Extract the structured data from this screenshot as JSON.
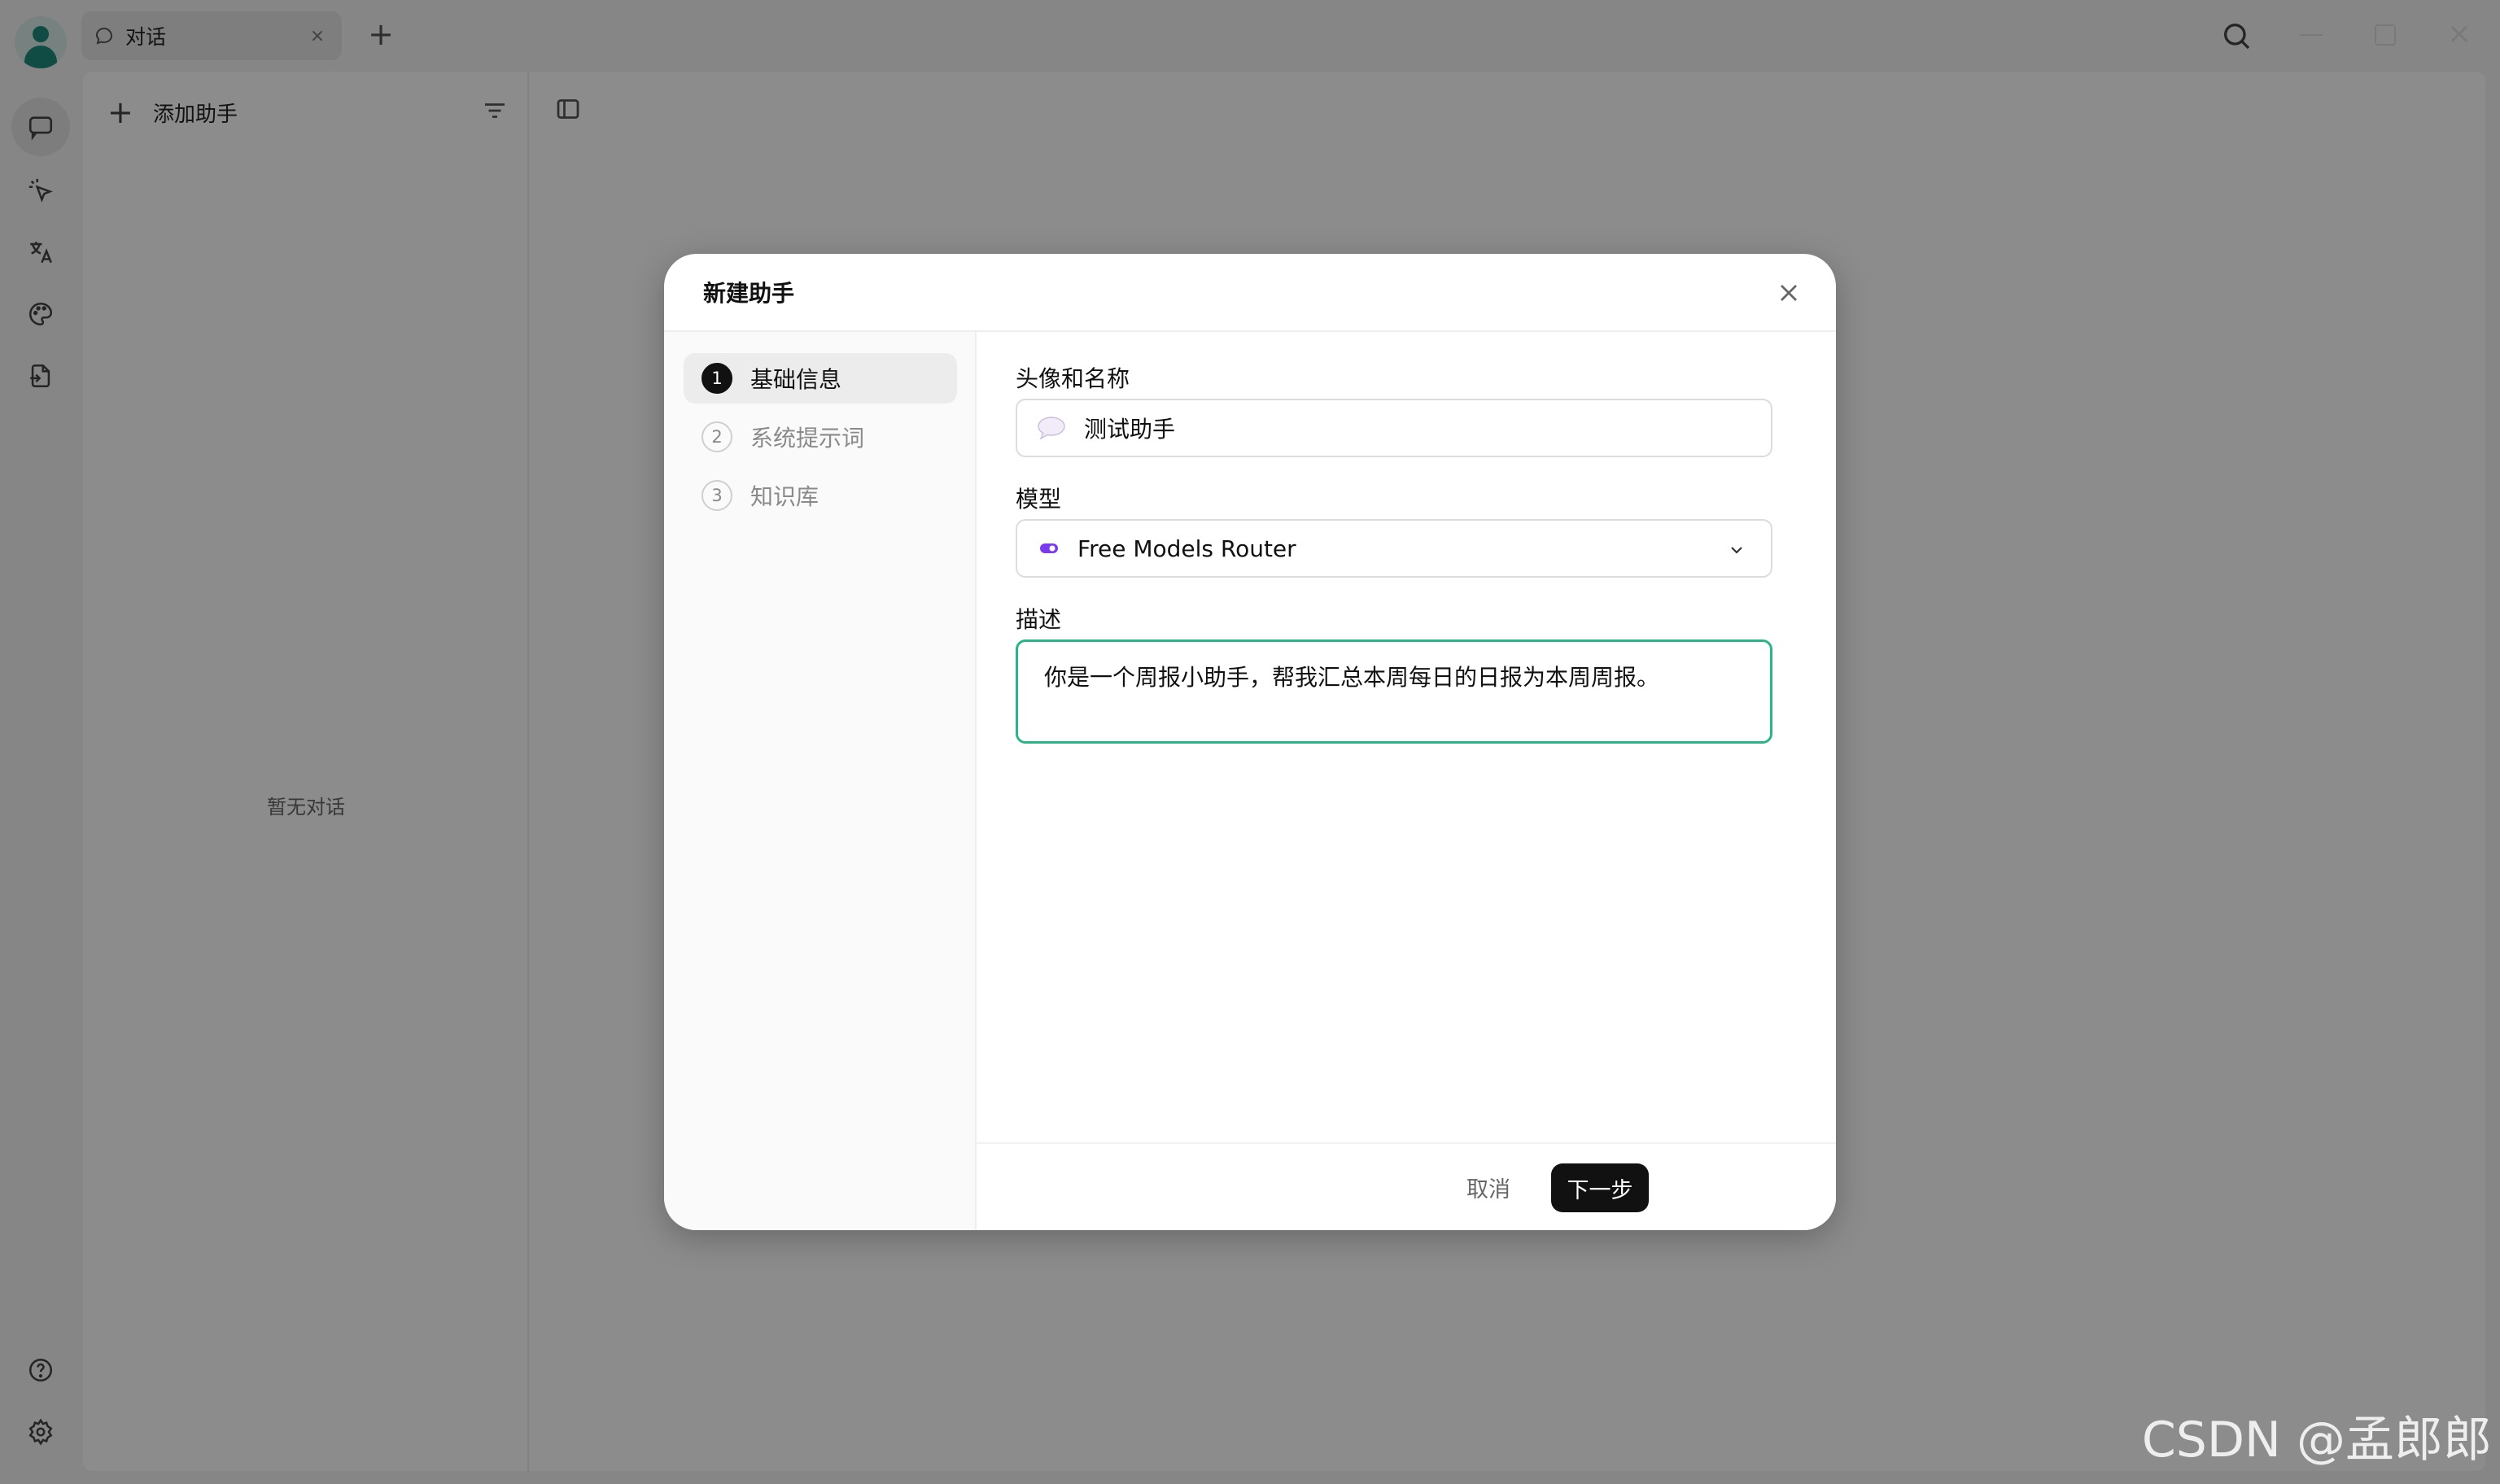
{
  "titlebar": {
    "tab_label": "对话",
    "tab_close": "×",
    "new_tab": "+",
    "window_close": "×"
  },
  "sidebar": {
    "add_label": "添加助手",
    "add_icon": "+",
    "empty_text": "暂无对话"
  },
  "iconbar": {
    "items": [
      "chat-icon",
      "pointer-sparkle-icon",
      "translate-icon",
      "palette-icon",
      "file-export-icon"
    ],
    "bottom": [
      "help-icon",
      "settings-icon"
    ]
  },
  "modal": {
    "title": "新建助手",
    "steps": [
      {
        "num": "1",
        "label": "基础信息",
        "active": true
      },
      {
        "num": "2",
        "label": "系统提示词",
        "active": false
      },
      {
        "num": "3",
        "label": "知识库",
        "active": false
      }
    ],
    "fields": {
      "name_label": "头像和名称",
      "name_value": "测试助手",
      "name_emoji": "speech-balloon-emoji",
      "model_label": "模型",
      "model_value": "Free Models Router",
      "desc_label": "描述",
      "desc_value": "你是一个周报小助手，帮我汇总本周每日的日报为本周周报。"
    },
    "cancel_label": "取消",
    "next_label": "下一步"
  },
  "colors": {
    "accent_green": "#2bb38a",
    "primary_button": "#111111",
    "model_icon": "#7c3aed"
  },
  "watermark": "CSDN @孟郎郎"
}
